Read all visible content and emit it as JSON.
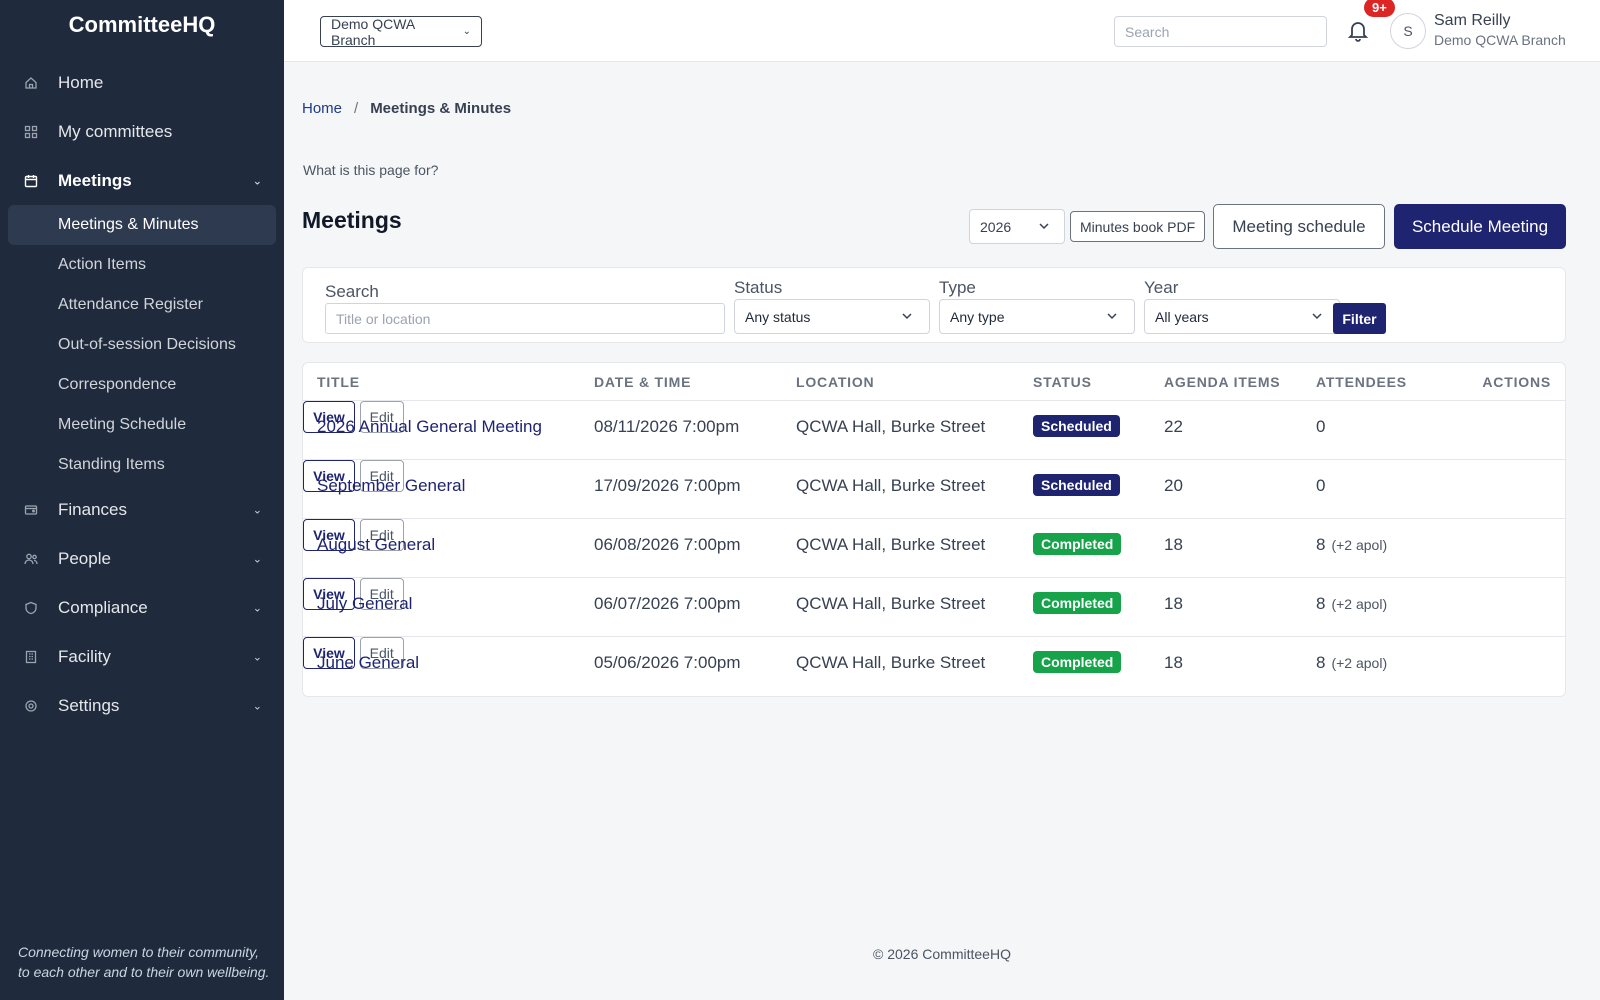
{
  "app": {
    "name": "CommitteeHQ",
    "tagline": "Connecting women to their community, to each other and to their own wellbeing."
  },
  "sidebar": {
    "items": [
      {
        "label": "Home",
        "icon": "home-icon"
      },
      {
        "label": "My committees",
        "icon": "grid-icon"
      },
      {
        "label": "Meetings",
        "icon": "calendar-icon",
        "expanded": true
      },
      {
        "label": "Finances",
        "icon": "wallet-icon"
      },
      {
        "label": "People",
        "icon": "people-icon"
      },
      {
        "label": "Compliance",
        "icon": "shield-icon"
      },
      {
        "label": "Facility",
        "icon": "building-icon"
      },
      {
        "label": "Settings",
        "icon": "gear-icon"
      }
    ],
    "meetings_sub": [
      {
        "label": "Meetings & Minutes",
        "active": true
      },
      {
        "label": "Action Items"
      },
      {
        "label": "Attendance Register"
      },
      {
        "label": "Out-of-session Decisions"
      },
      {
        "label": "Correspondence"
      },
      {
        "label": "Meeting Schedule"
      },
      {
        "label": "Standing Items"
      }
    ]
  },
  "topbar": {
    "branch": "Demo QCWA Branch",
    "search_placeholder": "Search",
    "notifications": "9+",
    "avatar_initial": "S",
    "user_name": "Sam Reilly",
    "user_branch": "Demo QCWA Branch"
  },
  "breadcrumb": {
    "home": "Home",
    "separator": "/",
    "current": "Meetings & Minutes"
  },
  "help_link": "What is this page for?",
  "page_title": "Meetings",
  "toolbar": {
    "year": "2026",
    "minutes_pdf": "Minutes book PDF",
    "meeting_schedule": "Meeting schedule",
    "schedule_meeting": "Schedule Meeting"
  },
  "filters": {
    "search_label": "Search",
    "search_placeholder": "Title or location",
    "status_label": "Status",
    "status_value": "Any status",
    "type_label": "Type",
    "type_value": "Any type",
    "year_label": "Year",
    "year_value": "All years",
    "filter_button": "Filter"
  },
  "table": {
    "columns": [
      "TITLE",
      "DATE & TIME",
      "LOCATION",
      "STATUS",
      "AGENDA ITEMS",
      "ATTENDEES",
      "ACTIONS"
    ],
    "rows": [
      {
        "title": "2026 Annual General Meeting",
        "datetime": "08/11/2026 7:00pm",
        "location": "QCWA Hall, Burke Street",
        "status": "Scheduled",
        "agenda": "22",
        "attendees": "0",
        "apol": ""
      },
      {
        "title": "September General",
        "datetime": "17/09/2026 7:00pm",
        "location": "QCWA Hall, Burke Street",
        "status": "Scheduled",
        "agenda": "20",
        "attendees": "0",
        "apol": ""
      },
      {
        "title": "August General",
        "datetime": "06/08/2026 7:00pm",
        "location": "QCWA Hall, Burke Street",
        "status": "Completed",
        "agenda": "18",
        "attendees": "8",
        "apol": "(+2 apol)"
      },
      {
        "title": "July General",
        "datetime": "06/07/2026 7:00pm",
        "location": "QCWA Hall, Burke Street",
        "status": "Completed",
        "agenda": "18",
        "attendees": "8",
        "apol": "(+2 apol)"
      },
      {
        "title": "June General",
        "datetime": "05/06/2026 7:00pm",
        "location": "QCWA Hall, Burke Street",
        "status": "Completed",
        "agenda": "18",
        "attendees": "8",
        "apol": "(+2 apol)"
      }
    ],
    "view_label": "View",
    "edit_label": "Edit"
  },
  "footer": "© 2026 CommitteeHQ",
  "colors": {
    "sidebar_bg": "#1f2a3c",
    "primary": "#1e2470",
    "completed": "#16a34a",
    "notif": "#dc2626"
  }
}
